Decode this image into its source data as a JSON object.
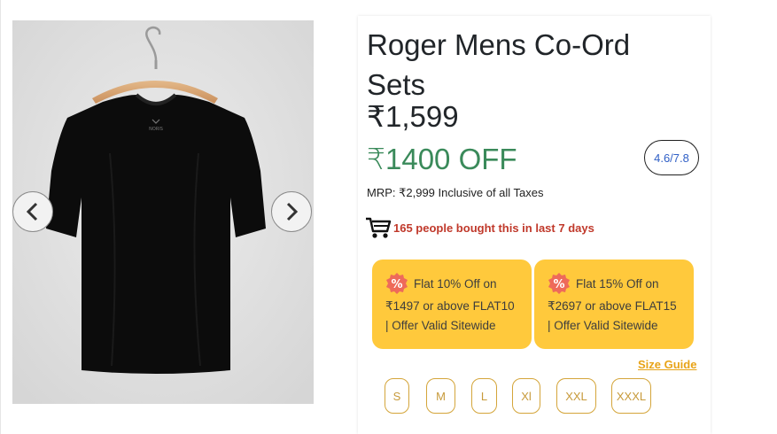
{
  "product": {
    "title": "Roger Mens Co-Ord Sets",
    "price": "₹1,599",
    "discount": "₹1400 OFF",
    "rating": "4.6/7.8",
    "mrp": "MRP: ₹2,999 Inclusive of all Taxes",
    "bought": "165 people bought this in last 7 days"
  },
  "gallery": {
    "prev_icon": "chevron-left-icon",
    "next_icon": "chevron-right-icon",
    "image": "black-tshirt-on-hanger",
    "brand_mark": "NORIS"
  },
  "offers": [
    {
      "line1": "Flat 10% Off on",
      "line2": "₹1497 or above FLAT10",
      "line3": "| Offer Valid Sitewide"
    },
    {
      "line1": "Flat 15% Off on",
      "line2": "₹2697 or above FLAT15",
      "line3": "| Offer Valid Sitewide"
    }
  ],
  "size_guide": "Size Guide",
  "sizes": [
    "S",
    "M",
    "L",
    "Xl",
    "XXL",
    "XXXL"
  ],
  "colors": {
    "discount_green": "#3a8a5a",
    "coupon_yellow": "#ffc93c",
    "bought_red": "#c0392b",
    "size_border": "#d4a53a"
  }
}
